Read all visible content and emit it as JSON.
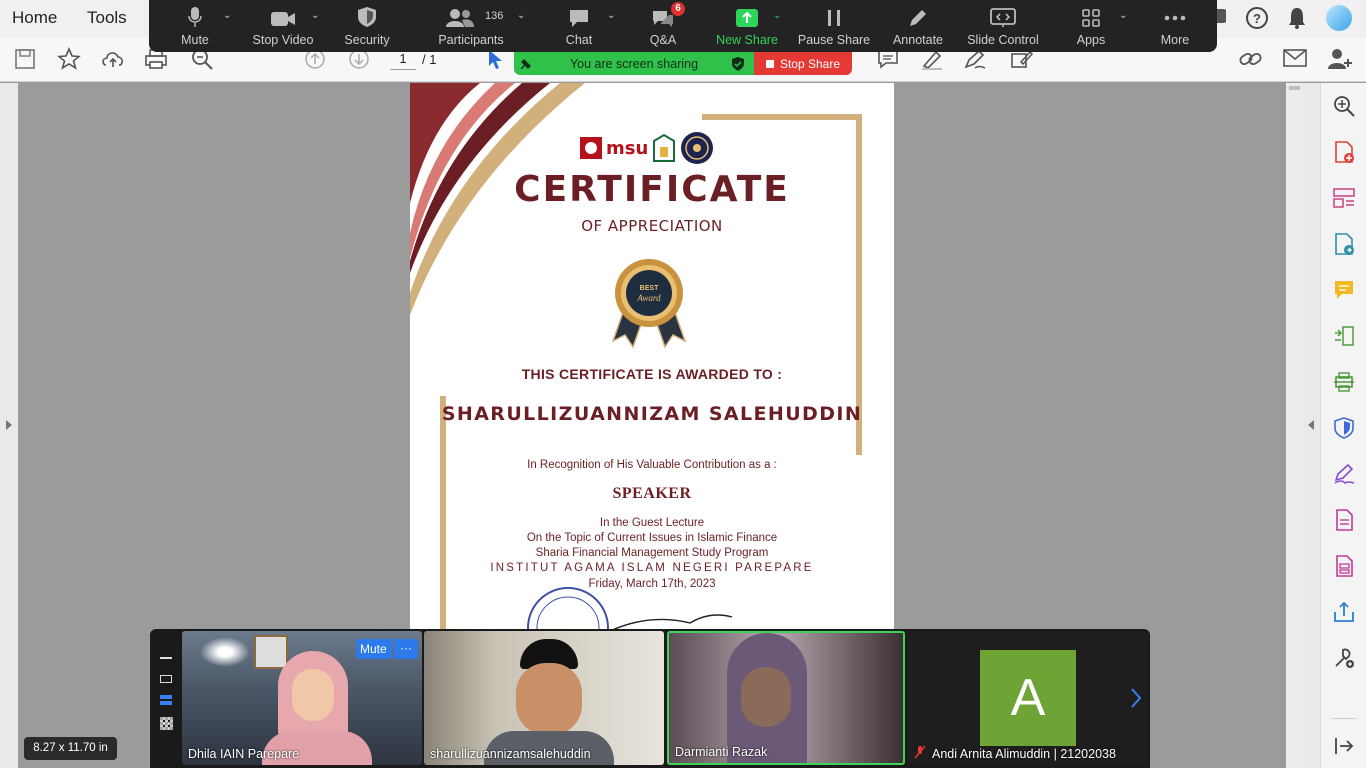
{
  "acrobat": {
    "menu_home": "Home",
    "menu_tools": "Tools",
    "page_current": "1",
    "page_total": "/ 1",
    "dimensions": "8.27 x 11.70 in"
  },
  "zoom": {
    "buttons": [
      {
        "label": "Mute",
        "icon": "microphone-icon"
      },
      {
        "label": "Stop Video",
        "icon": "video-camera-icon"
      },
      {
        "label": "Security",
        "icon": "shield-icon"
      },
      {
        "label": "Participants",
        "icon": "participants-icon"
      },
      {
        "label": "Chat",
        "icon": "chat-icon"
      },
      {
        "label": "Q&A",
        "icon": "qa-icon"
      },
      {
        "label": "New Share",
        "icon": "share-arrow-icon"
      },
      {
        "label": "Pause Share",
        "icon": "pause-icon"
      },
      {
        "label": "Annotate",
        "icon": "pencil-icon"
      },
      {
        "label": "Slide Control",
        "icon": "slide-control-icon"
      },
      {
        "label": "Apps",
        "icon": "apps-icon"
      },
      {
        "label": "More",
        "icon": "more-dots-icon"
      }
    ],
    "participant_count": "136",
    "qa_badge": "6",
    "share_banner_text": "You are screen sharing",
    "stop_share_label": "Stop Share",
    "accent_green": "#2fd45a",
    "stop_red": "#e53935"
  },
  "certificate": {
    "logo_text": "msu",
    "title": "CERTIFICATE",
    "subtitle": "OF APPRECIATION",
    "badge_line1": "BEST",
    "badge_line2": "Award",
    "awarded_to": "THIS CERTIFICATE IS AWARDED TO :",
    "recipient": "SHARULLIZUANNIZAM SALEHUDDIN",
    "recognition": "In Recognition of His Valuable Contribution as a :",
    "role": "SPEAKER",
    "line1": "In the Guest Lecture",
    "line2": "On the Topic of Current Issues in Islamic Finance",
    "line3": "Sharia Financial Management Study Program",
    "line4": "INSTITUT AGAMA ISLAM NEGERI PAREPARE",
    "date": "Friday, March 17th, 2023",
    "primary_color": "#6b1f24",
    "gold_color": "#d2b07b"
  },
  "gallery": {
    "mute_label": "Mute",
    "more_label": "···",
    "avatar_letter": "A",
    "participants": [
      {
        "name": "Dhila IAIN Parepare"
      },
      {
        "name": "sharullizuannizamsalehuddin"
      },
      {
        "name": "Darmianti Razak"
      },
      {
        "name": "Andi Arnita Alimuddin | 21202038"
      }
    ]
  }
}
